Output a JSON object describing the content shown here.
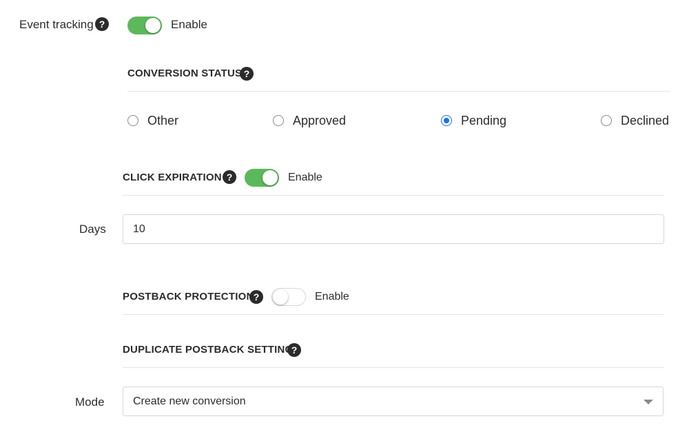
{
  "event_tracking": {
    "label": "Event tracking",
    "help_icon": "?",
    "toggle_label": "Enable",
    "enabled": true
  },
  "conversion_status": {
    "title": "CONVERSION STATUS",
    "help_icon": "?",
    "options": [
      {
        "label": "Other",
        "checked": false
      },
      {
        "label": "Approved",
        "checked": false
      },
      {
        "label": "Pending",
        "checked": true
      },
      {
        "label": "Declined",
        "checked": false
      }
    ]
  },
  "click_expiration": {
    "title": "CLICK EXPIRATION",
    "help_icon": "?",
    "toggle_label": "Enable",
    "enabled": true,
    "days_label": "Days",
    "days_value": "10"
  },
  "postback_protection": {
    "title": "POSTBACK PROTECTION",
    "help_icon": "?",
    "toggle_label": "Enable",
    "enabled": false
  },
  "duplicate_postback": {
    "title": "DUPLICATE POSTBACK SETTING",
    "help_icon": "?",
    "mode_label": "Mode",
    "mode_value": "Create new conversion"
  },
  "colors": {
    "toggle_on": "#5cb85c",
    "radio_checked": "#1a73e8",
    "help_badge": "#2b2b2b"
  }
}
